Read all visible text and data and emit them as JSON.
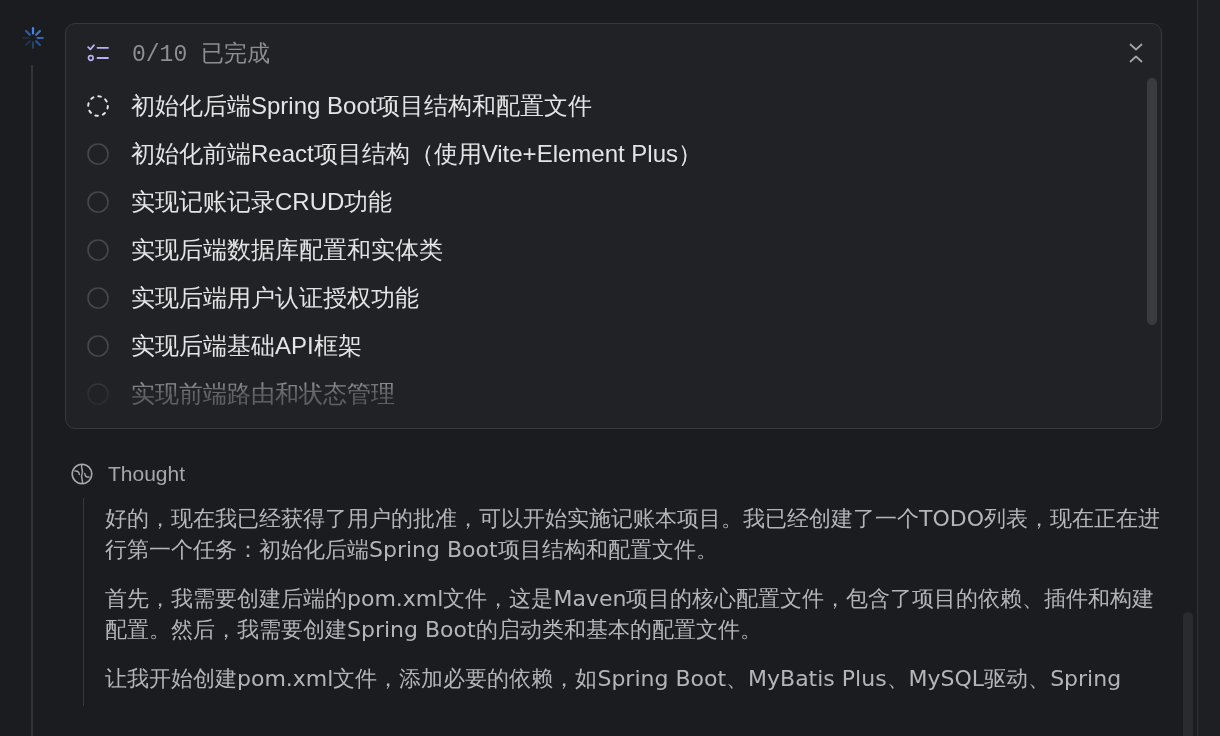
{
  "running": true,
  "todo": {
    "progress": "0/10 已完成",
    "expanded": true,
    "items": [
      {
        "text": "初始化后端Spring Boot项目结构和配置文件",
        "checked": false,
        "active": true
      },
      {
        "text": "初始化前端React项目结构（使用Vite+Element Plus）",
        "checked": false,
        "active": false
      },
      {
        "text": "实现记账记录CRUD功能",
        "checked": false,
        "active": false
      },
      {
        "text": "实现后端数据库配置和实体类",
        "checked": false,
        "active": false
      },
      {
        "text": "实现后端用户认证授权功能",
        "checked": false,
        "active": false
      },
      {
        "text": "实现后端基础API框架",
        "checked": false,
        "active": false
      },
      {
        "text": "实现前端路由和状态管理",
        "checked": false,
        "active": false
      }
    ]
  },
  "thought": {
    "label": "Thought",
    "paragraphs": [
      "好的，现在我已经获得了用户的批准，可以开始实施记账本项目。我已经创建了一个TODO列表，现在正在进行第一个任务：初始化后端Spring Boot项目结构和配置文件。",
      "首先，我需要创建后端的pom.xml文件，这是Maven项目的核心配置文件，包含了项目的依赖、插件和构建配置。然后，我需要创建Spring Boot的启动类和基本的配置文件。",
      "让我开始创建pom.xml文件，添加必要的依赖，如Spring Boot、MyBatis Plus、MySQL驱动、Spring"
    ]
  }
}
